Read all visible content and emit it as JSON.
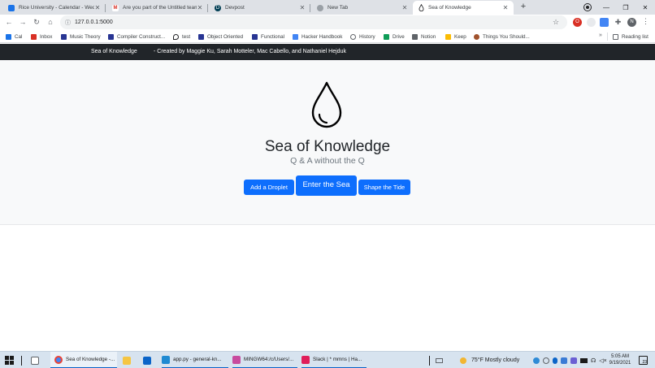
{
  "browser": {
    "tabs": [
      {
        "title": "Rice University - Calendar - Wedn...",
        "icon": "calendar-icon",
        "color": "#1a73e8"
      },
      {
        "title": "Are you part of the Untitled team?",
        "icon": "gmail-icon",
        "color": "#d93025"
      },
      {
        "title": "Devpost",
        "icon": "devpost-icon",
        "color": "#003e54"
      },
      {
        "title": "New Tab",
        "icon": "chrome-icon",
        "color": "#5f6368"
      },
      {
        "title": "Sea of Knowledge",
        "icon": "droplet-icon",
        "color": "#202124"
      }
    ],
    "new_tab_label": "+",
    "url": "127.0.0.1:5000",
    "profile_initial": "N",
    "bookmarks": [
      {
        "label": "Cal",
        "color": "#1a73e8"
      },
      {
        "label": "Inbox",
        "color": "#d93025"
      },
      {
        "label": "Music Theory",
        "color": "#283593"
      },
      {
        "label": "Compiler Construct...",
        "color": "#283593"
      },
      {
        "label": "test",
        "color": "#202124"
      },
      {
        "label": "Object Oriented",
        "color": "#283593"
      },
      {
        "label": "Functional",
        "color": "#283593"
      },
      {
        "label": "Hacker Handbook",
        "color": "#4285f4"
      },
      {
        "label": "History",
        "color": "#5f6368"
      },
      {
        "label": "Drive",
        "color": "#0f9d58"
      },
      {
        "label": "Notion",
        "color": "#5f6368"
      },
      {
        "label": "Keep",
        "color": "#fbbc04"
      },
      {
        "label": "Things You Should...",
        "color": "#a0522d"
      }
    ],
    "more_label": "»",
    "reading_list_label": "Reading list"
  },
  "site": {
    "brand": "Sea of Knowledge",
    "credits": "- Created by Maggie Ku, Sarah Motteler, Mac Cabello, and Nathaniel Hejduk",
    "title": "Sea of Knowledge",
    "subtitle": "Q & A without the Q",
    "buttons": {
      "add": "Add a Droplet",
      "enter": "Enter the Sea",
      "shape": "Shape the Tide"
    },
    "accent_color": "#0d6efd",
    "nav_color": "#212529"
  },
  "taskbar": {
    "apps": [
      {
        "label": "Sea of Knowledge -...",
        "icon": "chrome-icon"
      },
      {
        "label": "",
        "icon": "file-explorer-icon"
      },
      {
        "label": "",
        "icon": "outlook-icon"
      },
      {
        "label": "app.py - general-kn...",
        "icon": "vscode-icon"
      },
      {
        "label": "MINGW64:/c/Users/...",
        "icon": "git-bash-icon"
      },
      {
        "label": "Slack | * mmns | Ha...",
        "icon": "slack-icon"
      }
    ],
    "weather": "75°F  Mostly cloudy",
    "time": "5:05 AM",
    "date": "9/19/2021",
    "notification_count": "23"
  }
}
